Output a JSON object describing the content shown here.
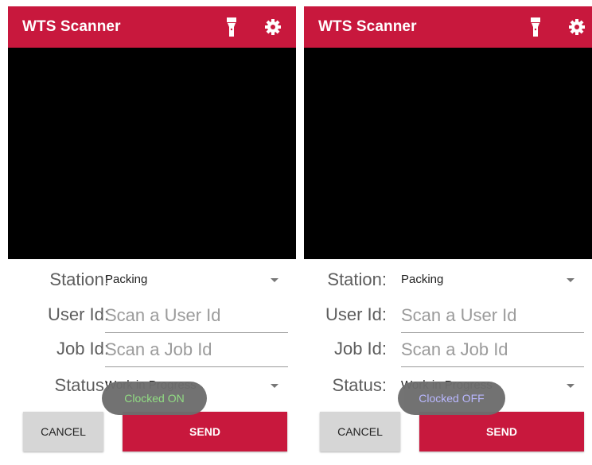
{
  "colors": {
    "accent": "#c8183d",
    "toast_on": "#8ddb7e",
    "toast_off": "#b7b5ff"
  },
  "left": {
    "appbar": {
      "title": "WTS Scanner"
    },
    "form": {
      "station_label": "Station:",
      "station_value": "Packing",
      "user_label": "User Id:",
      "user_placeholder": "Scan a User Id",
      "job_label": "Job Id:",
      "job_placeholder": "Scan a Job Id",
      "status_label": "Status:",
      "status_value": "Work in Progress"
    },
    "buttons": {
      "cancel": "CANCEL",
      "send": "SEND"
    },
    "toast": "Clocked ON"
  },
  "right": {
    "appbar": {
      "title": "WTS Scanner"
    },
    "form": {
      "station_label": "Station:",
      "station_value": "Packing",
      "user_label": "User Id:",
      "user_placeholder": "Scan a User Id",
      "job_label": "Job Id:",
      "job_placeholder": "Scan a Job Id",
      "status_label": "Status:",
      "status_value": "Work in Progress"
    },
    "buttons": {
      "cancel": "CANCEL",
      "send": "SEND"
    },
    "toast": "Clocked OFF"
  }
}
